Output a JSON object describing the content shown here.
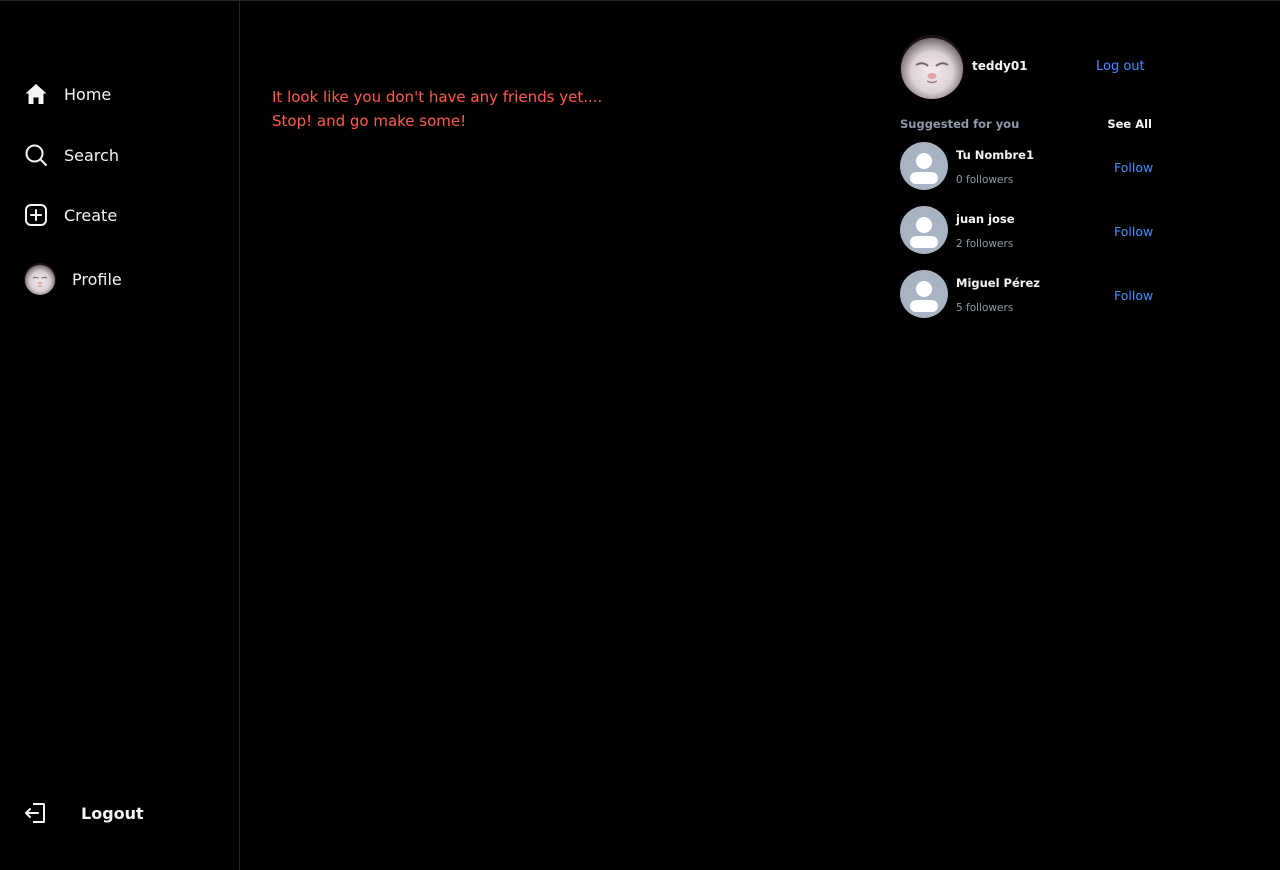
{
  "sidebar": {
    "items": [
      {
        "label": "Home",
        "icon": "home-icon"
      },
      {
        "label": "Search",
        "icon": "search-icon"
      },
      {
        "label": "Create",
        "icon": "plus-square-icon"
      },
      {
        "label": "Profile",
        "icon": "avatar"
      }
    ],
    "logout": {
      "label": "Logout",
      "icon": "logout-icon"
    }
  },
  "main": {
    "empty_line1": "It look like you don't have any friends yet....",
    "empty_line2": "Stop! and go make some!"
  },
  "right": {
    "user": {
      "username": "teddy01",
      "logout_label": "Log out"
    },
    "suggested_title": "Suggested for you",
    "see_all_label": "See All",
    "suggestions": [
      {
        "name": "Tu Nombre1",
        "followers": "0 followers",
        "action": "Follow"
      },
      {
        "name": "juan jose",
        "followers": "2 followers",
        "action": "Follow"
      },
      {
        "name": "Miguel Pérez",
        "followers": "5 followers",
        "action": "Follow"
      }
    ]
  },
  "colors": {
    "background": "#000000",
    "text": "#f5f5f5",
    "muted": "#8e9aa8",
    "link": "#4a8cff",
    "warning": "#ff5a4d",
    "divider": "#262626",
    "default_avatar_bg": "#a8b3c4"
  }
}
